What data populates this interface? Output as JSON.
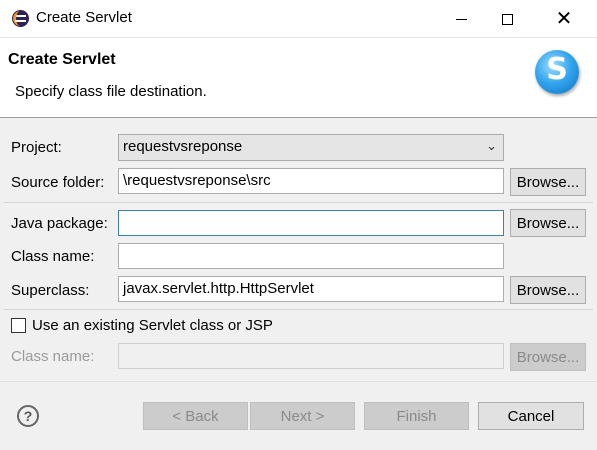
{
  "window": {
    "title": "Create Servlet",
    "close_glyph": "✕"
  },
  "banner": {
    "title": "Create Servlet",
    "description": "Specify class file destination.",
    "icon_letter": "S"
  },
  "form": {
    "project_label": "Project:",
    "project_value": "requestvsreponse",
    "source_folder_label": "Source folder:",
    "source_folder_value": "\\requestvsreponse\\src",
    "java_package_label": "Java package:",
    "java_package_value": "",
    "class_name_label": "Class name:",
    "class_name_value": "",
    "superclass_label": "Superclass:",
    "superclass_value": "javax.servlet.http.HttpServlet",
    "browse_label": "Browse...",
    "use_existing_label": "Use an existing Servlet class or JSP",
    "use_existing_checked": false,
    "existing_class_label": "Class name:",
    "existing_class_value": ""
  },
  "footer": {
    "help_glyph": "?",
    "back_label": "< Back",
    "next_label": "Next >",
    "finish_label": "Finish",
    "cancel_label": "Cancel"
  }
}
